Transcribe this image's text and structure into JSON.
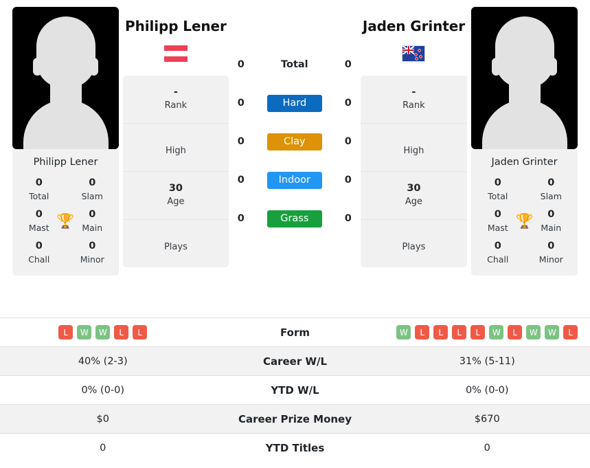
{
  "players": {
    "left": {
      "name": "Philipp Lener",
      "country_flag": "austria-flag",
      "card_name": "Philipp Lener",
      "titles": [
        {
          "value": "0",
          "label": "Total"
        },
        {
          "value": "0",
          "label": "Slam"
        },
        {
          "value": "0",
          "label": "Mast"
        },
        {
          "value": "0",
          "label": "Main"
        },
        {
          "value": "0",
          "label": "Chall"
        },
        {
          "value": "0",
          "label": "Minor"
        }
      ],
      "trophy_icon": "trophy-icon",
      "info": [
        {
          "value": "-",
          "label": "Rank"
        },
        {
          "value": "",
          "label": "High"
        },
        {
          "value": "30",
          "label": "Age"
        },
        {
          "value": "",
          "label": "Plays"
        }
      ],
      "surface_counts": {
        "total": "0",
        "hard": "0",
        "clay": "0",
        "indoor": "0",
        "grass": "0"
      },
      "form": [
        "L",
        "W",
        "W",
        "L",
        "L"
      ],
      "career_wl": "40% (2-3)",
      "ytd_wl": "0% (0-0)",
      "career_prize_money": "$0",
      "ytd_titles": "0"
    },
    "right": {
      "name": "Jaden Grinter",
      "country_flag": "new-zealand-flag",
      "card_name": "Jaden Grinter",
      "titles": [
        {
          "value": "0",
          "label": "Total"
        },
        {
          "value": "0",
          "label": "Slam"
        },
        {
          "value": "0",
          "label": "Mast"
        },
        {
          "value": "0",
          "label": "Main"
        },
        {
          "value": "0",
          "label": "Chall"
        },
        {
          "value": "0",
          "label": "Minor"
        }
      ],
      "trophy_icon": "trophy-icon",
      "info": [
        {
          "value": "-",
          "label": "Rank"
        },
        {
          "value": "",
          "label": "High"
        },
        {
          "value": "30",
          "label": "Age"
        },
        {
          "value": "",
          "label": "Plays"
        }
      ],
      "surface_counts": {
        "total": "0",
        "hard": "0",
        "clay": "0",
        "indoor": "0",
        "grass": "0"
      },
      "form": [
        "W",
        "L",
        "L",
        "L",
        "L",
        "W",
        "L",
        "W",
        "W",
        "L"
      ],
      "career_wl": "31% (5-11)",
      "ytd_wl": "0% (0-0)",
      "career_prize_money": "$670",
      "ytd_titles": "0"
    }
  },
  "surfaces": [
    {
      "key": "total",
      "label": "Total",
      "color": "transparent"
    },
    {
      "key": "hard",
      "label": "Hard",
      "color": "#0b6bbf"
    },
    {
      "key": "clay",
      "label": "Clay",
      "color": "#dd9207"
    },
    {
      "key": "indoor",
      "label": "Indoor",
      "color": "#2196f3"
    },
    {
      "key": "grass",
      "label": "Grass",
      "color": "#17a03c"
    }
  ],
  "table_labels": {
    "form": "Form",
    "career_wl": "Career W/L",
    "ytd_wl": "YTD W/L",
    "career_prize_money": "Career Prize Money",
    "ytd_titles": "YTD Titles"
  },
  "colors": {
    "win": "#7cc383",
    "loss": "#ef5a47",
    "panel_bg": "#f1f1f1",
    "stripe_bg": "#f2f2f2",
    "trophy": "#3c6fbe"
  }
}
